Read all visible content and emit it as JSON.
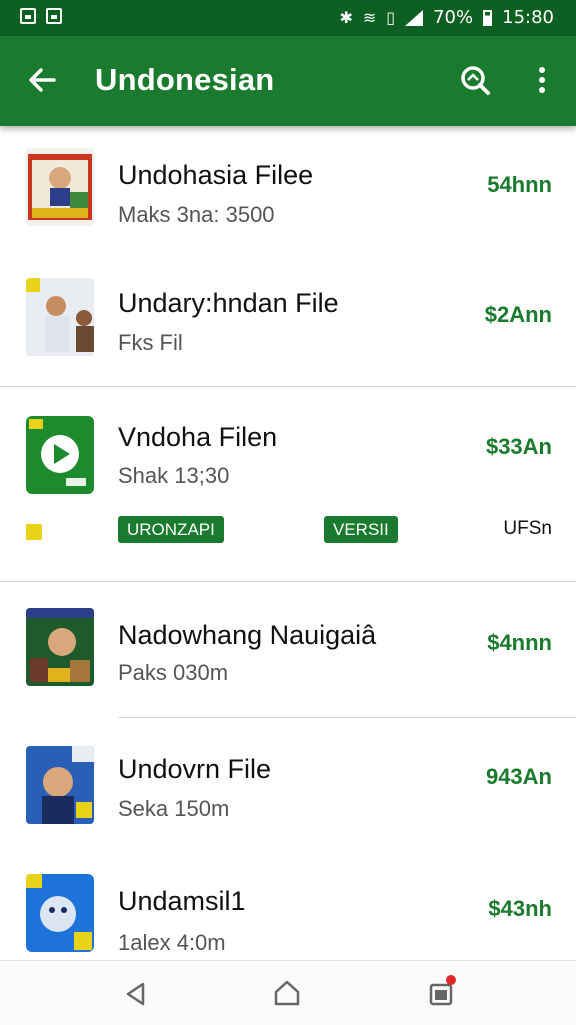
{
  "status_bar": {
    "battery": "70%",
    "time": "15:80"
  },
  "app_bar": {
    "title": "Undonesian"
  },
  "items": [
    {
      "name": "Undohasia Filee",
      "sub": "Maks 3na: 3500",
      "price": "54hnn"
    },
    {
      "name": "Undary:hndan File",
      "sub": "Fks Fil",
      "price": "$2Ann"
    },
    {
      "name": "Vndoha Filen",
      "sub": "Shak 13;30",
      "price": "$33An"
    },
    {
      "name": "Nadowhang Nauigaiâ",
      "sub": "Paks 030m",
      "price": "$4nnn"
    },
    {
      "name": "Undovrn File",
      "sub": "Seka 150m",
      "price": "943An"
    },
    {
      "name": "Undamsil1",
      "sub": "1alex 4:0m",
      "price": "$43nh"
    }
  ],
  "tags": {
    "pill1": "URONZAPI",
    "pill2": "VERSII",
    "text": "UFSn"
  },
  "icons": [
    "back-arrow-icon",
    "search-icon",
    "more-vert-icon",
    "nav-back-icon",
    "nav-home-icon",
    "nav-recents-icon"
  ],
  "colors": {
    "status": "#0e5f22",
    "appbar": "#1a7a2e",
    "price": "#1a7a2e",
    "badge": "#e0262a"
  }
}
